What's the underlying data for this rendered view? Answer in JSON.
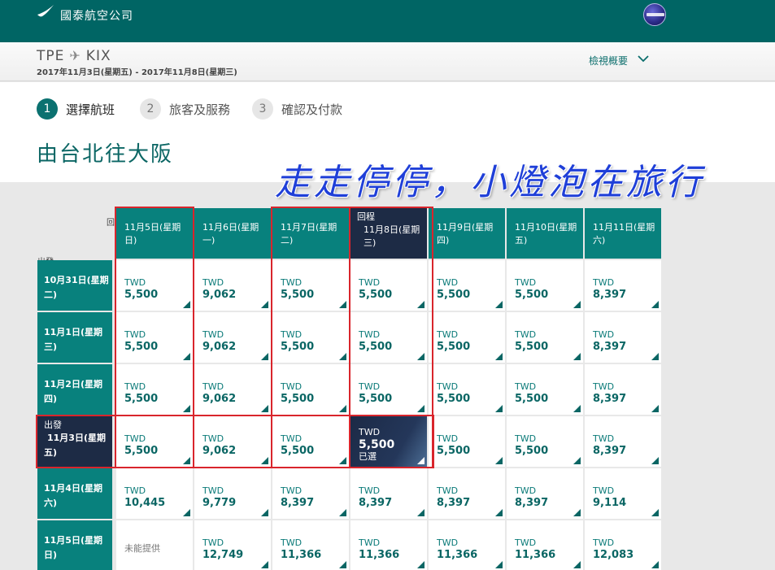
{
  "brand": "國泰航空公司",
  "summary": {
    "origin": "TPE",
    "destination": "KIX",
    "dates": "2017年11月3日(星期五) - 2017年11月8日(星期三)",
    "overview": "檢視概要"
  },
  "steps": [
    {
      "num": "1",
      "label": "選擇航班"
    },
    {
      "num": "2",
      "label": "旅客及服務"
    },
    {
      "num": "3",
      "label": "確認及付款"
    }
  ],
  "heading": "由台北往大阪",
  "watermark": "走走停停，小燈泡在旅行",
  "axis": {
    "return_label": "回",
    "depart_label": "出發"
  },
  "return_cols": [
    {
      "line1": "11月5日(星期",
      "line2": "日)"
    },
    {
      "line1": "11月6日(星期",
      "line2": "一)"
    },
    {
      "line1": "11月7日(星期",
      "line2": "二)"
    },
    {
      "tag": "回程",
      "line1": "11月8日(星期",
      "line2": "三)"
    },
    {
      "line1": "11月9日(星期",
      "line2": "四)"
    },
    {
      "line1": "11月10日(星期",
      "line2": "五)"
    },
    {
      "line1": "11月11日(星期",
      "line2": "六)"
    }
  ],
  "depart_rows": [
    {
      "line1": "10月31日(星期",
      "line2": "二)"
    },
    {
      "line1": "11月1日(星期",
      "line2": "三)"
    },
    {
      "line1": "11月2日(星期",
      "line2": "四)"
    },
    {
      "tag": "出發",
      "line1": "11月3日(星期",
      "line2": "五)"
    },
    {
      "line1": "11月4日(星期",
      "line2": "六)"
    },
    {
      "line1": "11月5日(星期",
      "line2": "日)"
    }
  ],
  "currency": "TWD",
  "not_available": "未能提供",
  "selected_label": "已選",
  "fares": [
    [
      "5,500",
      "9,062",
      "5,500",
      "5,500",
      "5,500",
      "5,500",
      "8,397"
    ],
    [
      "5,500",
      "9,062",
      "5,500",
      "5,500",
      "5,500",
      "5,500",
      "8,397"
    ],
    [
      "5,500",
      "9,062",
      "5,500",
      "5,500",
      "5,500",
      "5,500",
      "8,397"
    ],
    [
      "5,500",
      "9,062",
      "5,500",
      "5,500",
      "5,500",
      "5,500",
      "8,397"
    ],
    [
      "10,445",
      "9,779",
      "8,397",
      "8,397",
      "8,397",
      "8,397",
      "9,114"
    ],
    [
      "",
      "12,749",
      "11,366",
      "11,366",
      "11,366",
      "11,366",
      "12,083"
    ]
  ],
  "selected": {
    "row": 3,
    "col": 3
  },
  "colors": {
    "header_teal": "#08817d",
    "selected_navy": "#1d2b45",
    "topbar": "#006564",
    "highlight_red": "#d9252c"
  }
}
